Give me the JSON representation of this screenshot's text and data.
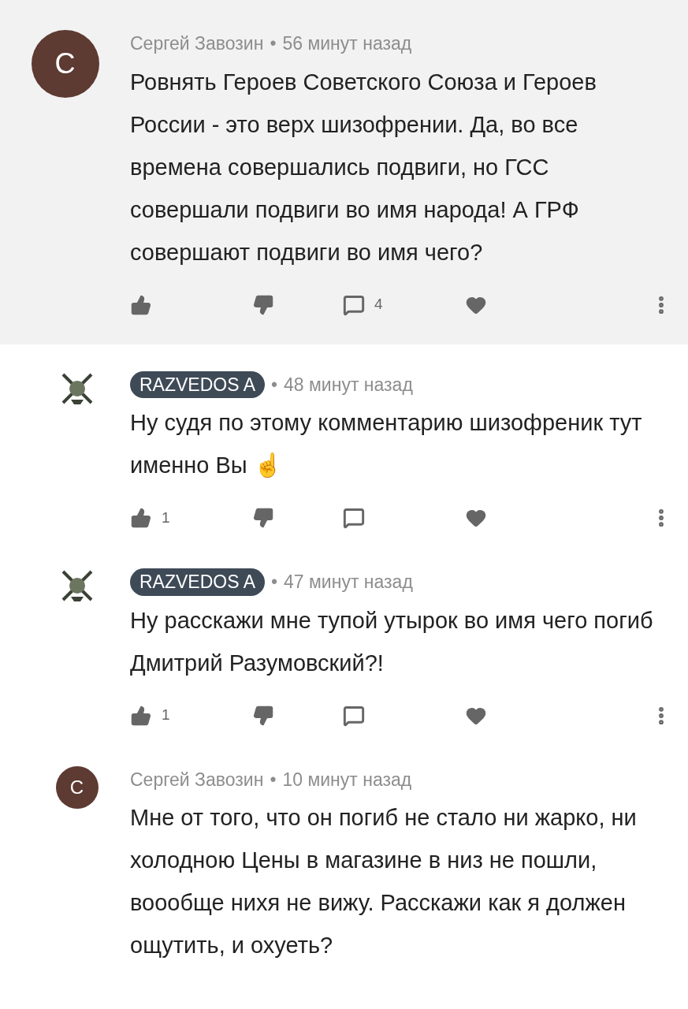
{
  "comments": [
    {
      "kind": "top",
      "highlighted": true,
      "avatar": {
        "kind": "letter",
        "letter": "С",
        "color": "#5d3a32"
      },
      "author": "Сергей Завозин",
      "author_badge": false,
      "separator": "•",
      "time": "56 минут назад",
      "text": "Ровнять Героев Советского Союза и Героев России  - это верх шизофрении. Да, во все времена совершались подвиги, но ГСС совершали подвиги во имя народа! А ГРФ совершают подвиги во имя чего?",
      "actions": {
        "replies": "4"
      }
    },
    {
      "kind": "reply",
      "highlighted": false,
      "avatar": {
        "kind": "emblem"
      },
      "author": "RAZVEDOS A",
      "author_badge": true,
      "separator": "•",
      "time": "48 минут назад",
      "text": "Ну судя по этому комментарию шизофреник тут именно Вы ☝",
      "actions": {
        "likes": "1"
      }
    },
    {
      "kind": "reply",
      "highlighted": false,
      "avatar": {
        "kind": "emblem"
      },
      "author": "RAZVEDOS A",
      "author_badge": true,
      "separator": "•",
      "time": "47 минут назад",
      "text": "Ну расскажи мне тупой утырок во имя чего погиб Дмитрий Разумовский?!",
      "actions": {
        "likes": "1"
      }
    },
    {
      "kind": "reply",
      "highlighted": false,
      "avatar": {
        "kind": "letter",
        "letter": "С",
        "color": "#5d3a32"
      },
      "author": "Сергей Завозин",
      "author_badge": false,
      "separator": "•",
      "time": "10 минут назад",
      "text": "Мне от того, что он погиб не стало ни жарко, ни холодною Цены в магазине в низ не пошли, воообще нихя не вижу. Расскажи как я должен ощутить, и охуеть?"
    }
  ]
}
